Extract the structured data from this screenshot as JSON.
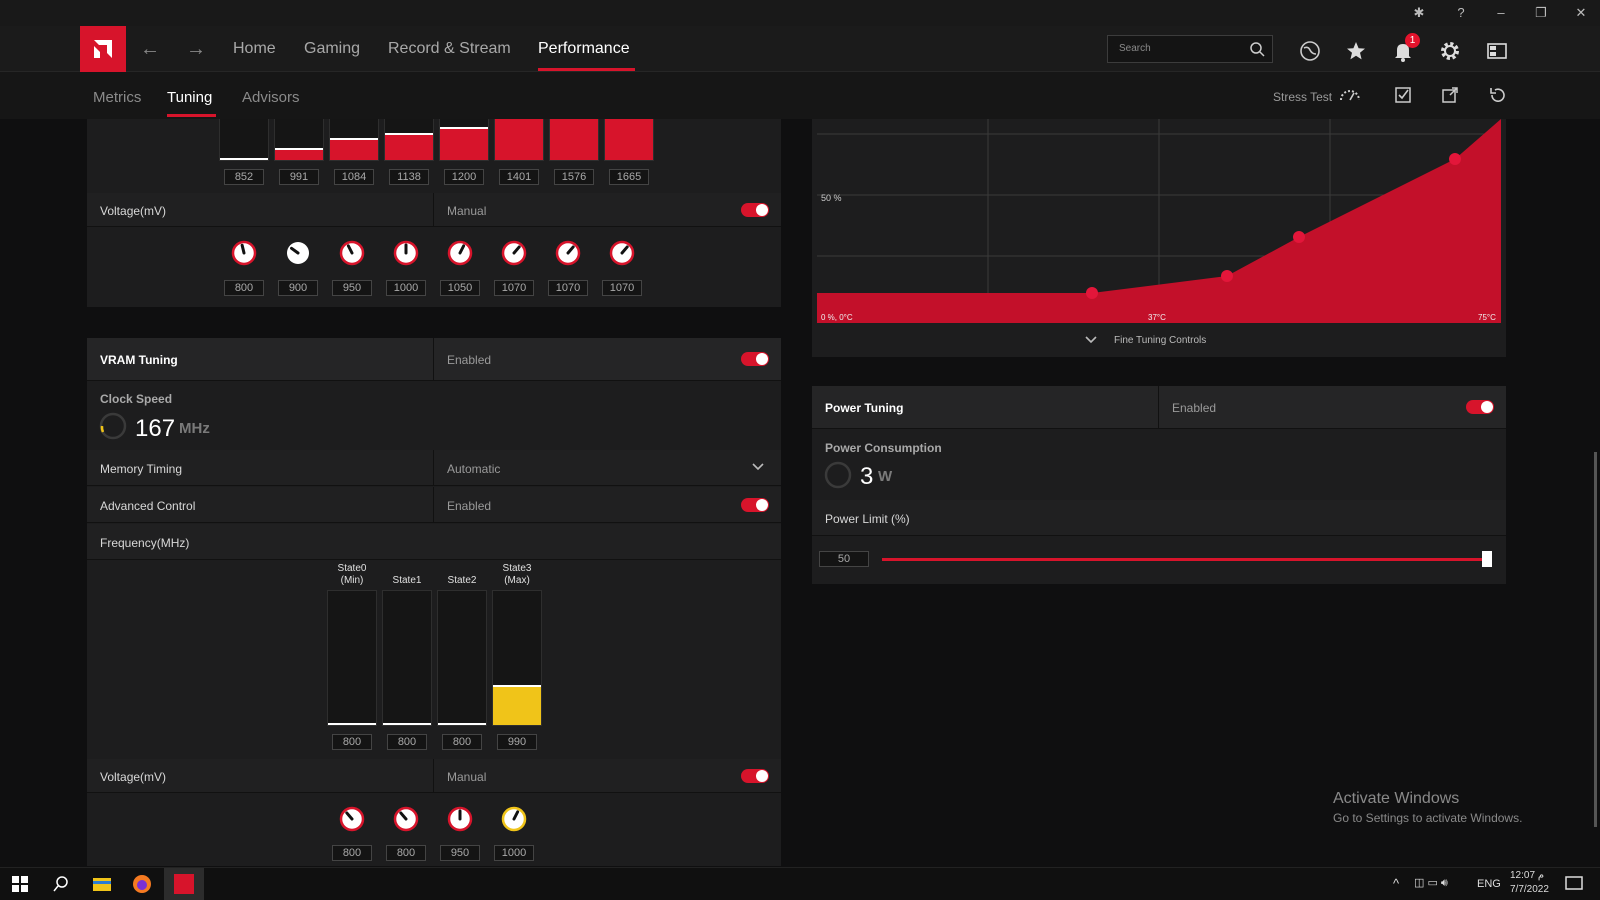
{
  "window": {
    "controls": [
      "bug-icon",
      "help-icon",
      "minimize-icon",
      "restore-icon",
      "close-icon"
    ]
  },
  "topnav": {
    "links": [
      "Home",
      "Gaming",
      "Record & Stream",
      "Performance"
    ],
    "active": "Performance",
    "search_placeholder": "Search",
    "notification_count": "1"
  },
  "subnav": {
    "tabs": [
      "Metrics",
      "Tuning",
      "Advisors"
    ],
    "active": "Tuning",
    "stress_test_label": "Stress Test"
  },
  "gpu_frequency_states": {
    "values": [
      "852",
      "991",
      "1084",
      "1138",
      "1200",
      "1401",
      "1576",
      "1665"
    ],
    "fill_fraction": [
      0.0,
      0.25,
      0.48,
      0.62,
      0.75,
      1.0,
      1.0,
      1.0
    ]
  },
  "gpu_voltage": {
    "label": "Voltage(mV)",
    "mode": "Manual",
    "enabled": true,
    "values": [
      "800",
      "900",
      "950",
      "1000",
      "1050",
      "1070",
      "1070",
      "1070"
    ]
  },
  "vram": {
    "title": "VRAM Tuning",
    "status": "Enabled",
    "clock_label": "Clock Speed",
    "clock_value": "167",
    "clock_unit": "MHz",
    "memory_timing_label": "Memory Timing",
    "memory_timing_value": "Automatic",
    "advanced_label": "Advanced Control",
    "advanced_value": "Enabled",
    "frequency_label": "Frequency(MHz)",
    "states": [
      "State0\n(Min)",
      "State1",
      "State2",
      "State3\n(Max)"
    ],
    "state_values": [
      "800",
      "800",
      "800",
      "990"
    ],
    "state_fill_fraction": [
      0,
      0,
      0,
      0.28
    ],
    "voltage_label": "Voltage(mV)",
    "voltage_mode": "Manual",
    "voltage_values": [
      "800",
      "800",
      "950",
      "1000"
    ]
  },
  "fan_curve": {
    "y_label": "50 %",
    "origin_label": "0 %, 0°C",
    "mid_temp": "37°C",
    "max_temp": "75°C",
    "fine_tuning_label": "Fine Tuning Controls"
  },
  "power": {
    "title": "Power Tuning",
    "status": "Enabled",
    "consumption_label": "Power Consumption",
    "consumption_value": "3",
    "consumption_unit": "W",
    "limit_label": "Power Limit (%)",
    "limit_value": "50",
    "limit_fraction": 1.0
  },
  "watermark": {
    "line1": "Activate Windows",
    "line2": "Go to Settings to activate Windows."
  },
  "taskbar": {
    "lang": "ENG",
    "time": "12:07 م",
    "date": "7/7/2022"
  }
}
